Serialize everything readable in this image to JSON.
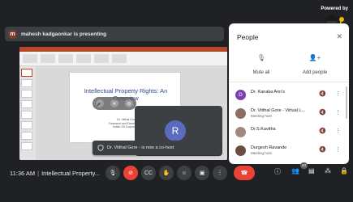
{
  "presenting_bar": {
    "avatar_letter": "m",
    "text": "mahesh kadgaonkar is presenting"
  },
  "branding": {
    "powered_by": "Powered by"
  },
  "slide": {
    "title": "Intellectual Property Rights: An Overview",
    "subtitle": "Dr. Vitthal Gore\nResearch and Development\nIndian Oil Corporation"
  },
  "self_tile": {
    "avatar_letter": "R"
  },
  "toast": {
    "text": "Dr. Vitthal Gore - is now a co-host"
  },
  "people_panel": {
    "title": "People",
    "mute_all_label": "Mute all",
    "add_people_label": "Add people",
    "participants": [
      {
        "name": "Dr. Kanaka Ann's",
        "role": "",
        "avatar_letter": "D",
        "avatar_color": "#7b3fb1"
      },
      {
        "name": "Dr. Vitthal Gore - Virtual L...",
        "role": "Meeting host",
        "avatar_letter": "",
        "avatar_color": "#8d6e63"
      },
      {
        "name": "Dr.S.Kavitha",
        "role": "",
        "avatar_letter": "",
        "avatar_color": "#a1887f"
      },
      {
        "name": "Durgesh Ravande",
        "role": "Meeting host",
        "avatar_letter": "",
        "avatar_color": "#6d4c41"
      }
    ]
  },
  "bottom_bar": {
    "time": "11:36 AM",
    "meeting_name": "Intellectual Property...",
    "participant_count": "44"
  },
  "colors": {
    "background": "#202124",
    "hangup_red": "#ea4335",
    "active_blue": "#8ab4f8"
  }
}
